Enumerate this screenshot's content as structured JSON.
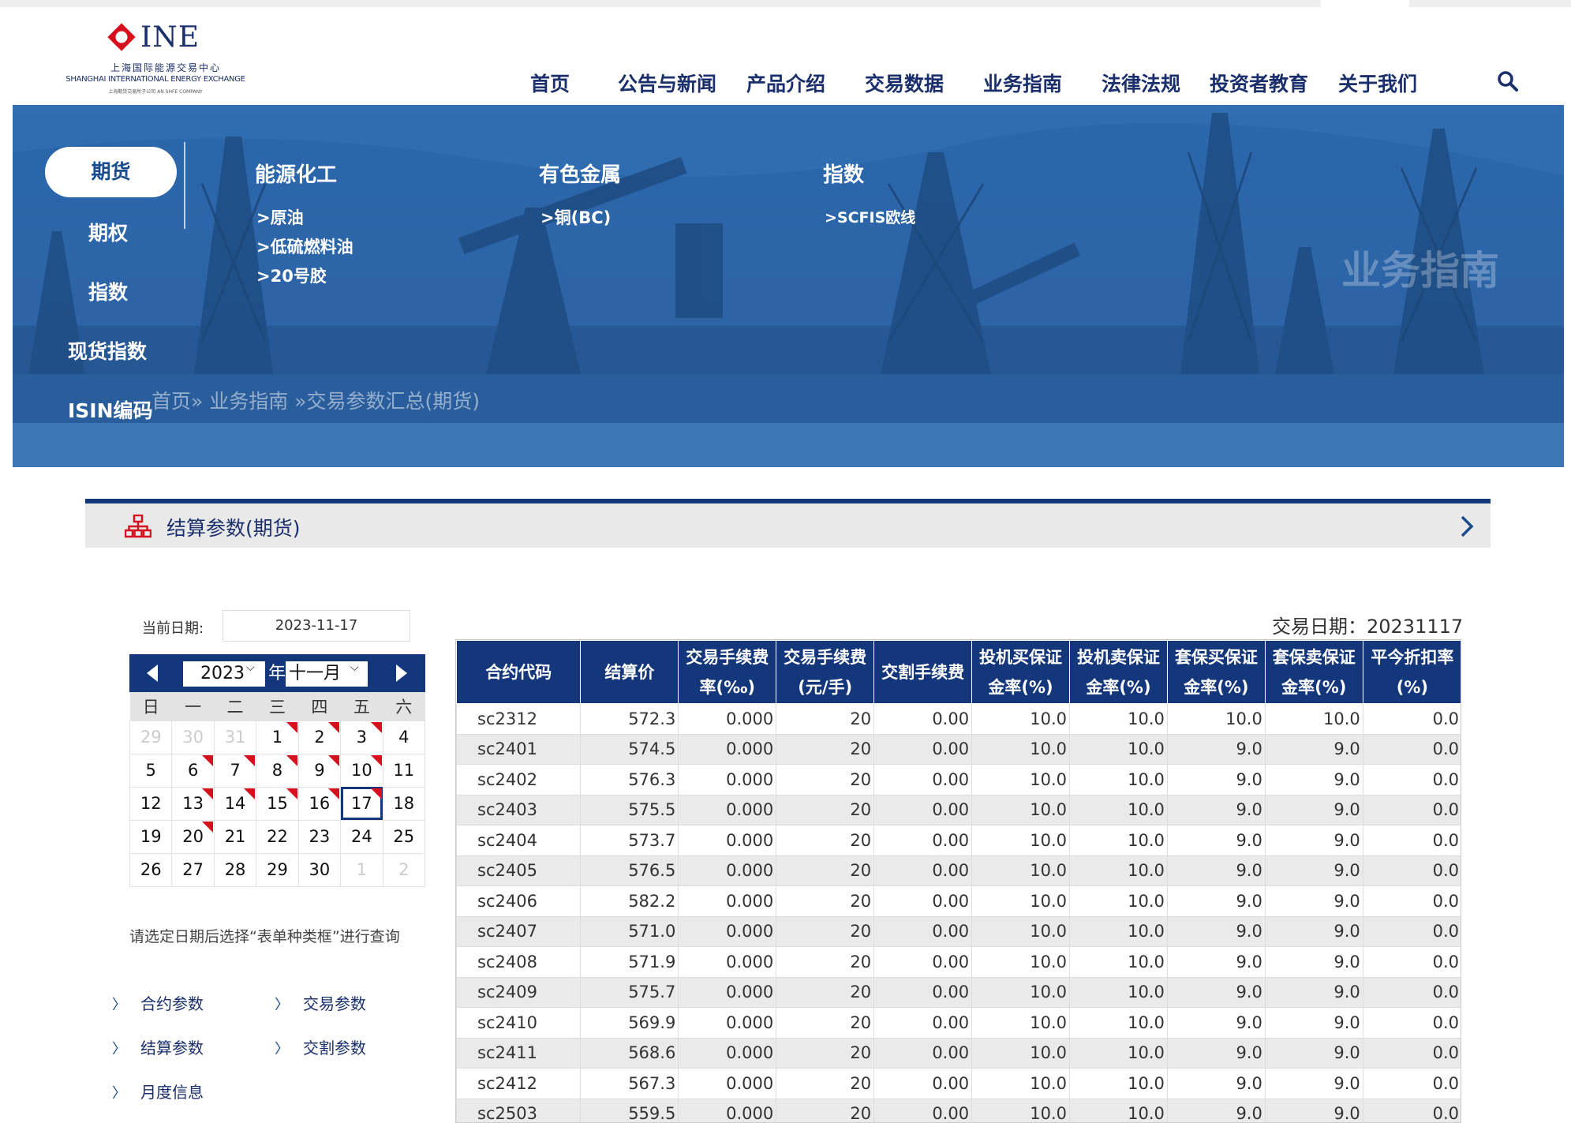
{
  "logo": {
    "name": "INE",
    "cn_name": "上海国际能源交易中心",
    "en_name": "SHANGHAI INTERNATIONAL ENERGY EXCHANGE",
    "sub": "上海期货交易所子公司 AN SHFE COMPANY"
  },
  "nav": {
    "items": [
      {
        "label": "首页"
      },
      {
        "label": "公告与新闻"
      },
      {
        "label": "产品介绍"
      },
      {
        "label": "交易数据"
      },
      {
        "label": "业务指南"
      },
      {
        "label": "法律法规"
      },
      {
        "label": "投资者教育"
      },
      {
        "label": "关于我们"
      }
    ]
  },
  "banner": {
    "watermark": "业务指南",
    "side_menu": [
      {
        "label": "期货"
      },
      {
        "label": "期权"
      },
      {
        "label": "指数"
      },
      {
        "label": "现货指数"
      },
      {
        "label": "ISIN编码"
      }
    ],
    "categories": [
      {
        "title": "能源化工",
        "links": [
          ">原油",
          ">低硫燃料油",
          ">20号胶"
        ]
      },
      {
        "title": "有色金属",
        "links": [
          ">铜(BC)"
        ]
      },
      {
        "title": "指数",
        "links": [
          ">SCFIS欧线"
        ]
      }
    ],
    "breadcrumb": "首页» 业务指南 »交易参数汇总(期货)"
  },
  "panel": {
    "title": "结算参数(期货)"
  },
  "calendar": {
    "date_label": "当前日期:",
    "date_value": "2023-11-17",
    "year": "2023",
    "year_suffix": "年",
    "month": "十一月",
    "weekdays": [
      "日",
      "一",
      "二",
      "三",
      "四",
      "五",
      "六"
    ],
    "weeks": [
      [
        {
          "d": "29",
          "o": true
        },
        {
          "d": "30",
          "o": true
        },
        {
          "d": "31",
          "o": true
        },
        {
          "d": "1",
          "f": true
        },
        {
          "d": "2",
          "f": true
        },
        {
          "d": "3",
          "f": true
        },
        {
          "d": "4"
        }
      ],
      [
        {
          "d": "5"
        },
        {
          "d": "6",
          "f": true
        },
        {
          "d": "7",
          "f": true
        },
        {
          "d": "8",
          "f": true
        },
        {
          "d": "9",
          "f": true
        },
        {
          "d": "10",
          "f": true
        },
        {
          "d": "11"
        }
      ],
      [
        {
          "d": "12"
        },
        {
          "d": "13",
          "f": true
        },
        {
          "d": "14",
          "f": true
        },
        {
          "d": "15",
          "f": true
        },
        {
          "d": "16",
          "f": true
        },
        {
          "d": "17",
          "f": true,
          "t": true
        },
        {
          "d": "18"
        }
      ],
      [
        {
          "d": "19"
        },
        {
          "d": "20",
          "f": true
        },
        {
          "d": "21"
        },
        {
          "d": "22"
        },
        {
          "d": "23"
        },
        {
          "d": "24"
        },
        {
          "d": "25"
        }
      ],
      [
        {
          "d": "26"
        },
        {
          "d": "27"
        },
        {
          "d": "28"
        },
        {
          "d": "29"
        },
        {
          "d": "30"
        },
        {
          "d": "1",
          "o": true
        },
        {
          "d": "2",
          "o": true
        }
      ]
    ],
    "hint": "请选定日期后选择“表单种类框”进行查询"
  },
  "quick_links": [
    {
      "label": "合约参数"
    },
    {
      "label": "交易参数"
    },
    {
      "label": "结算参数"
    },
    {
      "label": "交割参数"
    },
    {
      "label": "月度信息"
    }
  ],
  "table": {
    "trade_date": "交易日期：20231117",
    "headers": [
      [
        "合约代码"
      ],
      [
        "结算价"
      ],
      [
        "交易手续费",
        "率(‰)"
      ],
      [
        "交易手续费",
        "(元/手)"
      ],
      [
        "交割手续费"
      ],
      [
        "投机买保证",
        "金率(%)"
      ],
      [
        "投机卖保证",
        "金率(%)"
      ],
      [
        "套保买保证",
        "金率(%)"
      ],
      [
        "套保卖保证",
        "金率(%)"
      ],
      [
        "平今折扣率",
        "(%)"
      ]
    ],
    "rows": [
      [
        "sc2312",
        "572.3",
        "0.000",
        "20",
        "0.00",
        "10.0",
        "10.0",
        "10.0",
        "10.0",
        "0.0"
      ],
      [
        "sc2401",
        "574.5",
        "0.000",
        "20",
        "0.00",
        "10.0",
        "10.0",
        "9.0",
        "9.0",
        "0.0"
      ],
      [
        "sc2402",
        "576.3",
        "0.000",
        "20",
        "0.00",
        "10.0",
        "10.0",
        "9.0",
        "9.0",
        "0.0"
      ],
      [
        "sc2403",
        "575.5",
        "0.000",
        "20",
        "0.00",
        "10.0",
        "10.0",
        "9.0",
        "9.0",
        "0.0"
      ],
      [
        "sc2404",
        "573.7",
        "0.000",
        "20",
        "0.00",
        "10.0",
        "10.0",
        "9.0",
        "9.0",
        "0.0"
      ],
      [
        "sc2405",
        "576.5",
        "0.000",
        "20",
        "0.00",
        "10.0",
        "10.0",
        "9.0",
        "9.0",
        "0.0"
      ],
      [
        "sc2406",
        "582.2",
        "0.000",
        "20",
        "0.00",
        "10.0",
        "10.0",
        "9.0",
        "9.0",
        "0.0"
      ],
      [
        "sc2407",
        "571.0",
        "0.000",
        "20",
        "0.00",
        "10.0",
        "10.0",
        "9.0",
        "9.0",
        "0.0"
      ],
      [
        "sc2408",
        "571.9",
        "0.000",
        "20",
        "0.00",
        "10.0",
        "10.0",
        "9.0",
        "9.0",
        "0.0"
      ],
      [
        "sc2409",
        "575.7",
        "0.000",
        "20",
        "0.00",
        "10.0",
        "10.0",
        "9.0",
        "9.0",
        "0.0"
      ],
      [
        "sc2410",
        "569.9",
        "0.000",
        "20",
        "0.00",
        "10.0",
        "10.0",
        "9.0",
        "9.0",
        "0.0"
      ],
      [
        "sc2411",
        "568.6",
        "0.000",
        "20",
        "0.00",
        "10.0",
        "10.0",
        "9.0",
        "9.0",
        "0.0"
      ],
      [
        "sc2412",
        "567.3",
        "0.000",
        "20",
        "0.00",
        "10.0",
        "10.0",
        "9.0",
        "9.0",
        "0.0"
      ],
      [
        "sc2503",
        "559.5",
        "0.000",
        "20",
        "0.00",
        "10.0",
        "10.0",
        "9.0",
        "9.0",
        "0.0"
      ]
    ]
  },
  "colors": {
    "brand_navy": "#14377b",
    "banner_blue": "#2a63a6",
    "flag_red": "#d6101c"
  },
  "icons": {
    "search": "search-icon",
    "panel": "sitemap-icon",
    "panel_more": "chevron-right-icon",
    "cal_prev": "triangle-left-icon",
    "cal_next": "triangle-right-icon",
    "link": "chevron-right-icon"
  }
}
